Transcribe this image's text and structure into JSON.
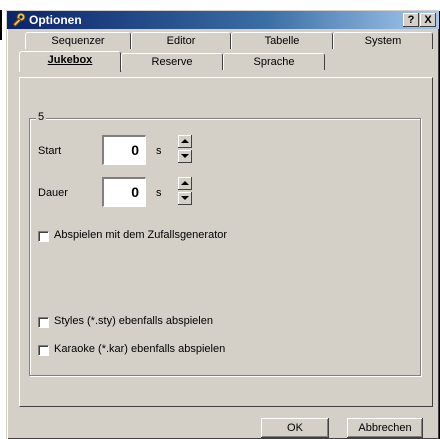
{
  "window": {
    "title": "Optionen"
  },
  "titlebar_buttons": {
    "help": "?",
    "close": "X"
  },
  "tabs_row1": [
    {
      "label": "Sequenzer"
    },
    {
      "label": "Editor"
    },
    {
      "label": "Tabelle"
    },
    {
      "label": "System"
    }
  ],
  "tabs_row2": [
    {
      "label": "Jukebox",
      "selected": true
    },
    {
      "label": "Reserve"
    },
    {
      "label": "Sprache"
    }
  ],
  "group": {
    "title": "5"
  },
  "start": {
    "label": "Start",
    "value": "0",
    "unit": "s"
  },
  "dauer": {
    "label": "Dauer",
    "value": "0",
    "unit": "s"
  },
  "checkboxes": {
    "random": {
      "label": "Abspielen mit dem Zufallsgenerator",
      "checked": false
    },
    "styles": {
      "label": "Styles (*.sty) ebenfalls abspielen",
      "checked": false
    },
    "karaoke": {
      "label": "Karaoke (*.kar) ebenfalls abspielen",
      "checked": false
    }
  },
  "buttons": {
    "ok": "OK",
    "cancel": "Abbrechen"
  },
  "colors": {
    "face": "#d4d0c8",
    "titlebar": "#0a246a"
  }
}
